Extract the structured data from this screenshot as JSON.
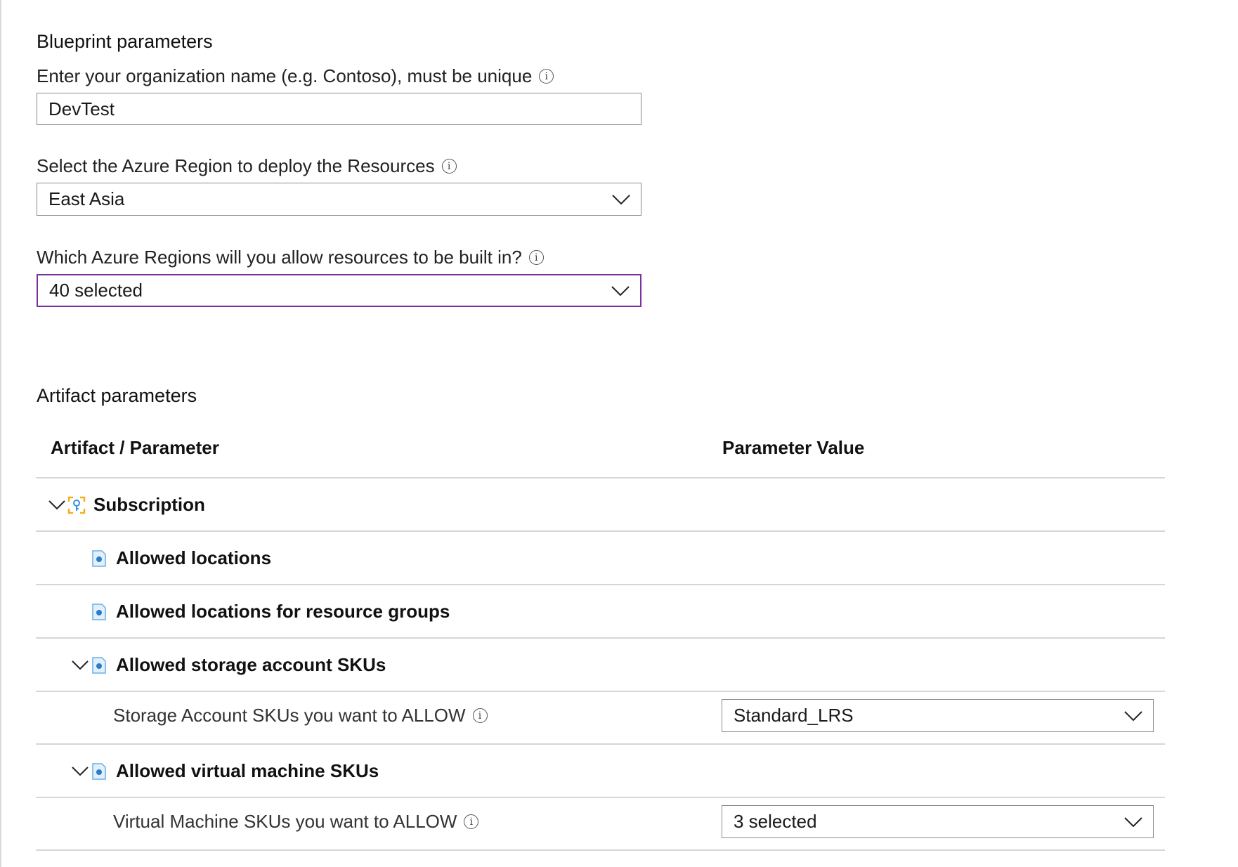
{
  "blueprint": {
    "title": "Blueprint parameters",
    "org_label": "Enter your organization name (e.g. Contoso), must be unique",
    "org_value": "DevTest",
    "region_label": "Select the Azure Region to deploy the Resources",
    "region_value": "East Asia",
    "allowed_regions_label": "Which Azure Regions will you allow resources to be built in?",
    "allowed_regions_value": "40 selected"
  },
  "artifacts": {
    "title": "Artifact parameters",
    "columns": [
      "Artifact / Parameter",
      "Parameter Value"
    ],
    "subscription_label": "Subscription",
    "allowed_locations_label": "Allowed locations",
    "allowed_locations_rg_label": "Allowed locations for resource groups",
    "storage_skus_label": "Allowed storage account SKUs",
    "storage_param_label": "Storage Account SKUs you want to ALLOW",
    "storage_param_value": "Standard_LRS",
    "vm_skus_label": "Allowed virtual machine SKUs",
    "vm_param_label": "Virtual Machine SKUs you want to ALLOW",
    "vm_param_value": "3 selected"
  },
  "icons": {
    "info": "info-circle-icon",
    "chevron": "chevron-down-icon",
    "subscription": "subscription-key-icon",
    "policy": "policy-document-icon"
  },
  "colors": {
    "focus_border": "#7b2f9a",
    "policy_icon": "#3a8fd4",
    "subscription_icon": "#f2b01e"
  }
}
